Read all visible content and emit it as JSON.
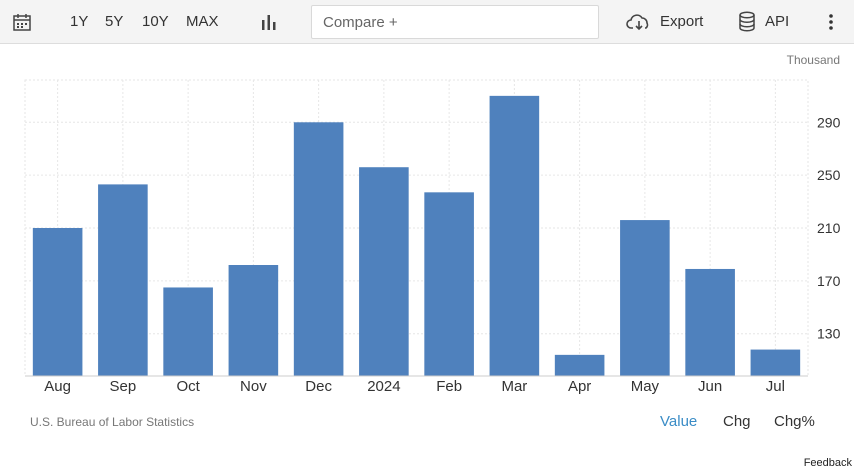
{
  "toolbar": {
    "ranges": [
      "1Y",
      "5Y",
      "10Y",
      "MAX"
    ],
    "compare_placeholder": "Compare +",
    "export_label": "Export",
    "api_label": "API",
    "icons": [
      "calendar-icon",
      "bar-chart-icon",
      "cloud-download-icon",
      "database-icon",
      "kebab-menu-icon"
    ]
  },
  "chart_data": {
    "type": "bar",
    "categories": [
      "Aug",
      "Sep",
      "Oct",
      "Nov",
      "Dec",
      "2024",
      "Feb",
      "Mar",
      "Apr",
      "May",
      "Jun",
      "Jul"
    ],
    "values": [
      210,
      243,
      165,
      182,
      290,
      256,
      237,
      310,
      114,
      216,
      179,
      118
    ],
    "unit": "Thousand",
    "ylim": [
      98,
      322
    ],
    "yticks": [
      130,
      170,
      210,
      250,
      290
    ],
    "grid": true,
    "color": "#4f81bd"
  },
  "footer": {
    "source": "U.S. Bureau of Labor Statistics",
    "tabs": [
      "Value",
      "Chg",
      "Chg%"
    ],
    "active_tab": "Value",
    "active_color": "#3a8cc6",
    "feedback": "Feedback"
  }
}
